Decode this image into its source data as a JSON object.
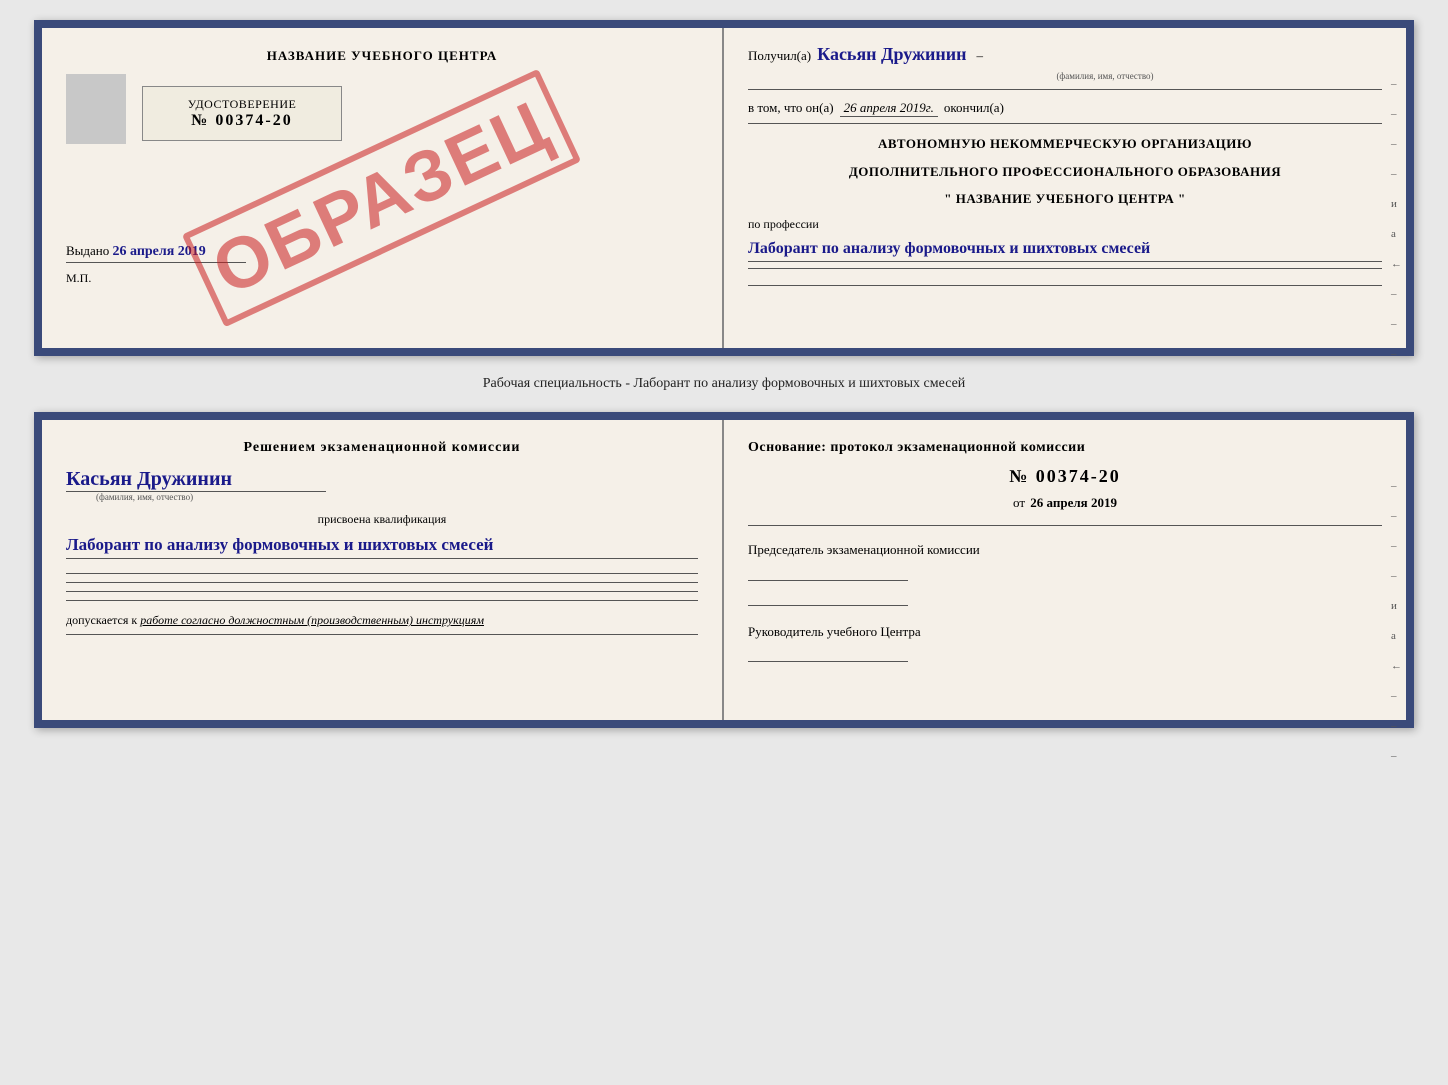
{
  "page": {
    "bg_color": "#e8e8e8"
  },
  "top_card": {
    "left": {
      "title": "НАЗВАНИЕ УЧЕБНОГО ЦЕНТРА",
      "cert_label": "УДОСТОВЕРЕНИЕ",
      "cert_number": "№ 00374-20",
      "stamp": "ОБРАЗЕЦ",
      "issued_label": "Выдано",
      "issued_date": "26 апреля 2019",
      "mp_label": "М.П."
    },
    "right": {
      "received_label": "Получил(а)",
      "received_name": "Касьян Дружинин",
      "fio_sublabel": "(фамилия, имя, отчество)",
      "completed_prefix": "в том, что он(а)",
      "completed_date": "26 апреля 2019г.",
      "completed_suffix": "окончил(а)",
      "org_line1": "АВТОНОМНУЮ НЕКОММЕРЧЕСКУЮ ОРГАНИЗАЦИЮ",
      "org_line2": "ДОПОЛНИТЕЛЬНОГО ПРОФЕССИОНАЛЬНОГО ОБРАЗОВАНИЯ",
      "org_line3": "\"   НАЗВАНИЕ УЧЕБНОГО ЦЕНТРА   \"",
      "profession_prefix": "по профессии",
      "profession_value": "Лаборант по анализу формовочных и шихтовых смесей",
      "side_marks": [
        "–",
        "–",
        "–",
        "–",
        "и",
        "а",
        "←",
        "–",
        "–",
        "–"
      ]
    }
  },
  "specialty_line": "Рабочая специальность - Лаборант по анализу формовочных и шихтовых смесей",
  "bottom_card": {
    "left": {
      "decision_label": "Решением экзаменационной комиссии",
      "person_name": "Касьян Дружинин",
      "fio_sublabel": "(фамилия, имя, отчество)",
      "qualification_prefix": "присвоена квалификация",
      "qualification_value": "Лаборант по анализу формовочных и шихтовых смесей",
      "допуск_prefix": "допускается к",
      "допуск_value": "работе согласно должностным (производственным) инструкциям"
    },
    "right": {
      "basis_label": "Основание: протокол экзаменационной комиссии",
      "protocol_number": "№ 00374-20",
      "date_prefix": "от",
      "protocol_date": "26 апреля 2019",
      "chairman_label": "Председатель экзаменационной комиссии",
      "head_label": "Руководитель учебного Центра",
      "side_marks": [
        "–",
        "–",
        "–",
        "–",
        "и",
        "а",
        "←",
        "–",
        "–",
        "–"
      ]
    }
  }
}
